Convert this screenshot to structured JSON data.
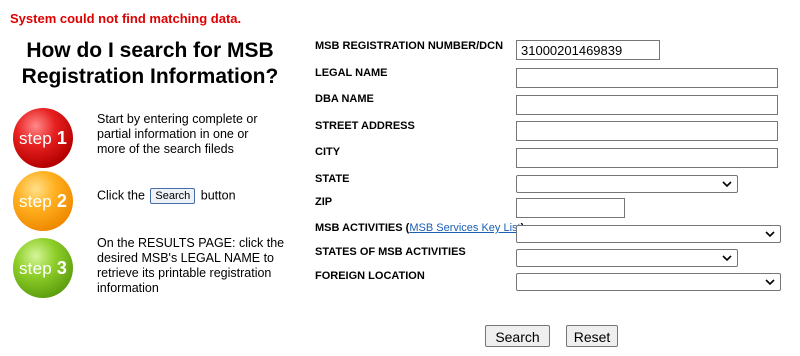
{
  "error_message": "System could not find matching data.",
  "heading": "How do I search for MSB Registration Information?",
  "steps": [
    {
      "badge": "step",
      "number": "1",
      "color": "#e01f1f",
      "text": "Start by entering complete or partial information in one or more of the search fileds"
    },
    {
      "badge": "step",
      "number": "2",
      "color": "#f7a21b",
      "text_before": "Click the",
      "button_label": "Search",
      "text_after": "button"
    },
    {
      "badge": "step",
      "number": "3",
      "color": "#7cc128",
      "text": "On the RESULTS PAGE: click the desired MSB's LEGAL NAME to retrieve its printable registration information"
    }
  ],
  "form": {
    "registration_number": {
      "label": "MSB REGISTRATION NUMBER/DCN",
      "value": "31000201469839"
    },
    "legal_name": {
      "label": "LEGAL NAME",
      "value": ""
    },
    "dba_name": {
      "label": "DBA NAME",
      "value": ""
    },
    "street_address": {
      "label": "STREET ADDRESS",
      "value": ""
    },
    "city": {
      "label": "CITY",
      "value": ""
    },
    "state": {
      "label": "STATE",
      "selected": ""
    },
    "zip": {
      "label": "ZIP",
      "value": ""
    },
    "msb_activities": {
      "label": "MSB ACTIVITIES",
      "link_text": "MSB Services Key List",
      "selected": ""
    },
    "states_of_msb_activities": {
      "label": "STATES OF MSB ACTIVITIES",
      "selected": ""
    },
    "foreign_location": {
      "label": "FOREIGN LOCATION",
      "selected": ""
    }
  },
  "buttons": {
    "search": "Search",
    "reset": "Reset"
  }
}
